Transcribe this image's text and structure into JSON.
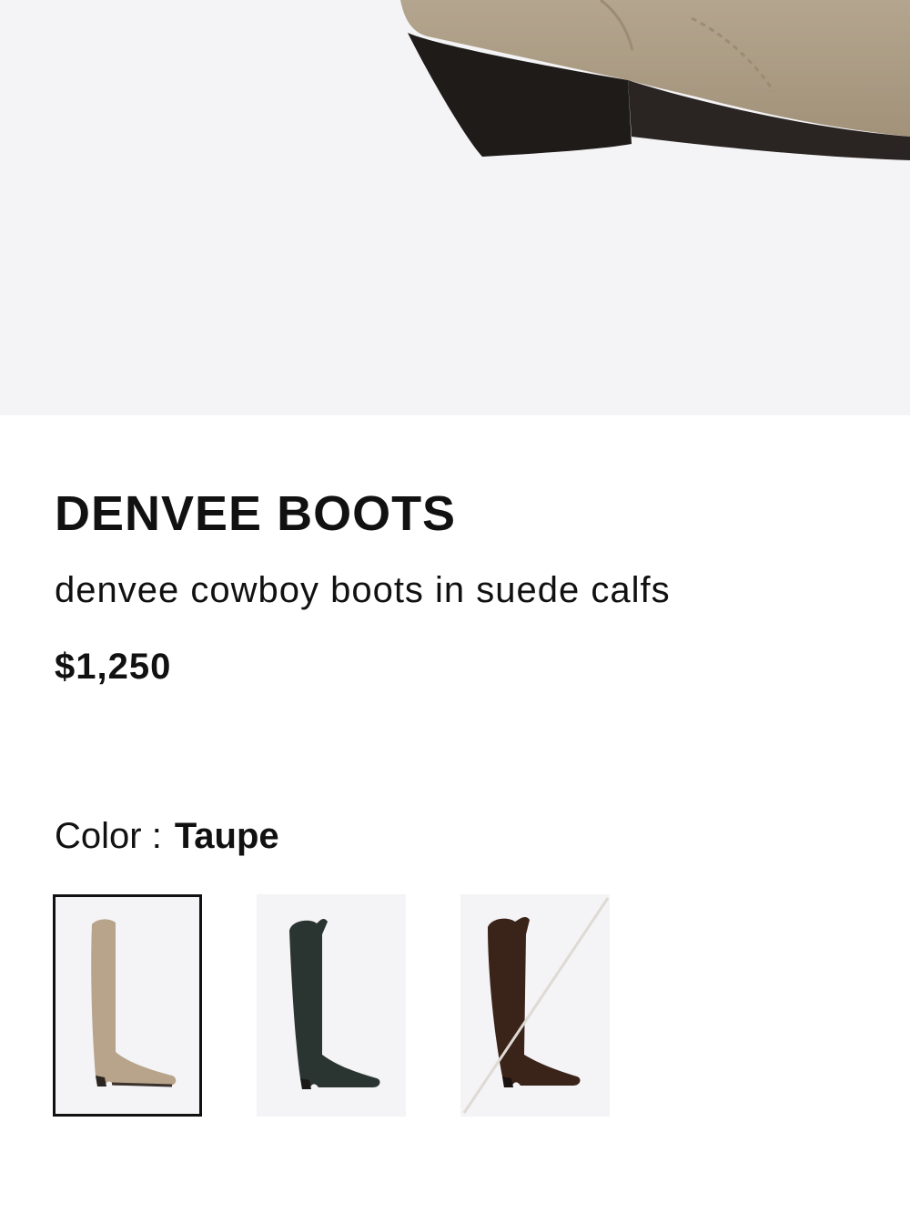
{
  "product": {
    "title": "DENVEE BOOTS",
    "subtitle": "denvee cowboy boots in suede calfs",
    "price": "$1,250"
  },
  "color": {
    "label": "Color :",
    "selected": "Taupe",
    "swatches": [
      {
        "name": "Taupe",
        "hex": "#b7a48a",
        "selected": true,
        "available": true
      },
      {
        "name": "Dark green",
        "hex": "#2a3431",
        "selected": false,
        "available": true
      },
      {
        "name": "Brown",
        "hex": "#3a2319",
        "selected": false,
        "available": false
      }
    ]
  }
}
